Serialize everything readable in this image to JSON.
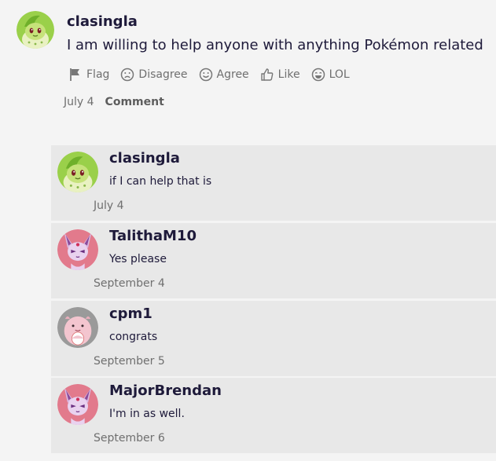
{
  "main_comment": {
    "avatar_icon": "chikorita-avatar-icon",
    "username": "clasingla",
    "text": "I am willing to help anyone with anything Pokémon related",
    "actions": [
      {
        "label": "Flag",
        "icon": "flag-icon"
      },
      {
        "label": "Disagree",
        "icon": "frown-icon"
      },
      {
        "label": "Agree",
        "icon": "smile-icon"
      },
      {
        "label": "Like",
        "icon": "thumbs-up-icon"
      },
      {
        "label": "LOL",
        "icon": "laugh-icon"
      }
    ],
    "date": "July 4",
    "comment_link": "Comment"
  },
  "replies": [
    {
      "username": "clasingla",
      "text": "if I can help that is",
      "date": "July 4",
      "avatar_icon": "chikorita-avatar-icon"
    },
    {
      "username": "TalithaM10",
      "text": "Yes please",
      "date": "September 4",
      "avatar_icon": "espeon-avatar-icon"
    },
    {
      "username": "cpm1",
      "text": "congrats",
      "date": "September 5",
      "avatar_icon": "chansey-avatar-icon"
    },
    {
      "username": "MajorBrendan",
      "text": "I'm in as well.",
      "date": "September 6",
      "avatar_icon": "espeon-avatar-icon"
    }
  ],
  "colors": {
    "page_bg": "#f4f4f4",
    "reply_bg": "#e8e8e8",
    "text": "#1e1a3a",
    "muted": "#6f6f6f"
  }
}
